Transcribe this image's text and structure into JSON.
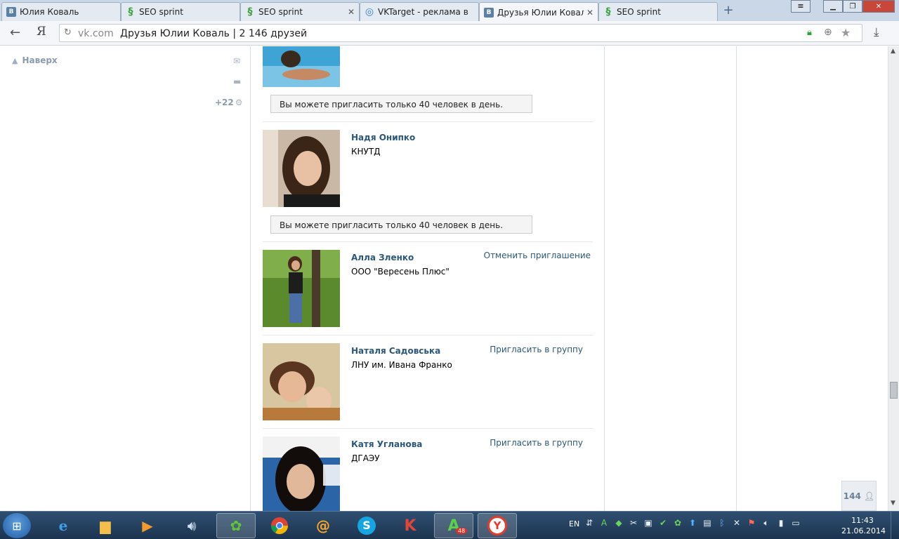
{
  "browser": {
    "tabs": [
      {
        "label": "Юлия Коваль",
        "icon": "vk-icon",
        "active": false
      },
      {
        "label": "SEO sprint",
        "icon": "seosprint-icon",
        "active": false
      },
      {
        "label": "SEO sprint",
        "icon": "seosprint-icon",
        "active": false
      },
      {
        "label": "VKTarget - реклама в",
        "icon": "vktarget-icon",
        "active": false
      },
      {
        "label": "Друзья Юлии Коваль",
        "icon": "vk-icon",
        "active": true
      },
      {
        "label": "SEO sprint",
        "icon": "seosprint-icon",
        "active": false
      }
    ],
    "tab_icon_text": "B",
    "address": {
      "host": "vk.com",
      "title": "Друзья Юлии Коваль | 2 146 друзей"
    },
    "yandex_letter": "Я"
  },
  "sidebar": {
    "to_top": "Наверх",
    "counter": "+22"
  },
  "friends": [
    {
      "name": "",
      "subtitle": "",
      "action": "",
      "notice": "Вы можете пригласить только 40 человек в день.",
      "photo": {
        "bg": "#3ea4d6",
        "skin": "#c58a63",
        "hair": "#3a2a1e"
      }
    },
    {
      "name": "Надя Онипко",
      "subtitle": "КНУТД",
      "action": "",
      "notice": "Вы можете пригласить только 40 человек в день.",
      "photo": {
        "bg": "#c9b8a6",
        "skin": "#e8c1a4",
        "hair": "#3b2516"
      }
    },
    {
      "name": "Алла Зленко",
      "subtitle": "ООО \"Вересень Плюс\"",
      "action": "Отменить приглашение",
      "notice": "",
      "photo": {
        "bg": "#5b8a2c",
        "skin": "#d9a98a",
        "hair": "#4a2a1a"
      }
    },
    {
      "name": "Наталя Садовська",
      "subtitle": "ЛНУ им. Ивана Франко",
      "action": "Пригласить в группу",
      "notice": "",
      "photo": {
        "bg": "#d7c6a0",
        "skin": "#e6b896",
        "hair": "#5a3520"
      }
    },
    {
      "name": "Катя Угланова",
      "subtitle": "ДГАЭУ",
      "action": "Пригласить в группу",
      "notice": "",
      "photo": {
        "bg": "#2c64a8",
        "skin": "#e2b89a",
        "hair": "#120c0a"
      }
    }
  ],
  "online_badge": "144",
  "taskbar": {
    "lang": "EN",
    "time": "11:43",
    "date": "21.06.2014",
    "apps": [
      "ie-icon",
      "explorer-icon",
      "media-player-icon",
      "volume-app-icon",
      "icq-icon",
      "chrome-icon",
      "mail-agent-icon",
      "skype-icon",
      "kaspersky-icon",
      "agent-icon",
      "yandex-browser-icon"
    ],
    "agent_badge": "48"
  },
  "colors": {
    "link": "#2b587a",
    "divider": "#e4e8ec",
    "notice_bg": "#f4f4f4"
  }
}
